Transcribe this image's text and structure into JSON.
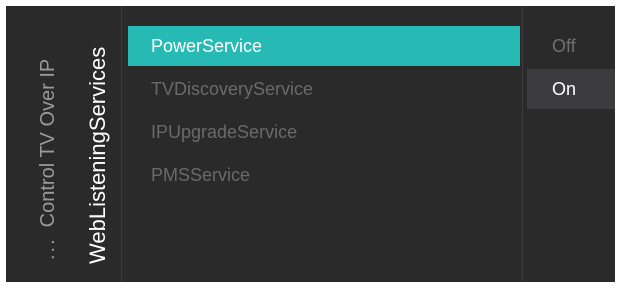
{
  "breadcrumb": {
    "ellipsis": "...",
    "parent": "Control TV Over IP",
    "current": "WebListeningServices"
  },
  "services": {
    "items": [
      {
        "label": "PowerService"
      },
      {
        "label": "TVDiscoveryService"
      },
      {
        "label": "IPUpgradeService"
      },
      {
        "label": "PMSService"
      }
    ],
    "selected_index": 0
  },
  "options": {
    "items": [
      {
        "label": "Off"
      },
      {
        "label": "On"
      }
    ],
    "current": "On"
  },
  "colors": {
    "background": "#2a2a2b",
    "accent": "#27bab4",
    "option_highlight": "#3c3c3e"
  }
}
